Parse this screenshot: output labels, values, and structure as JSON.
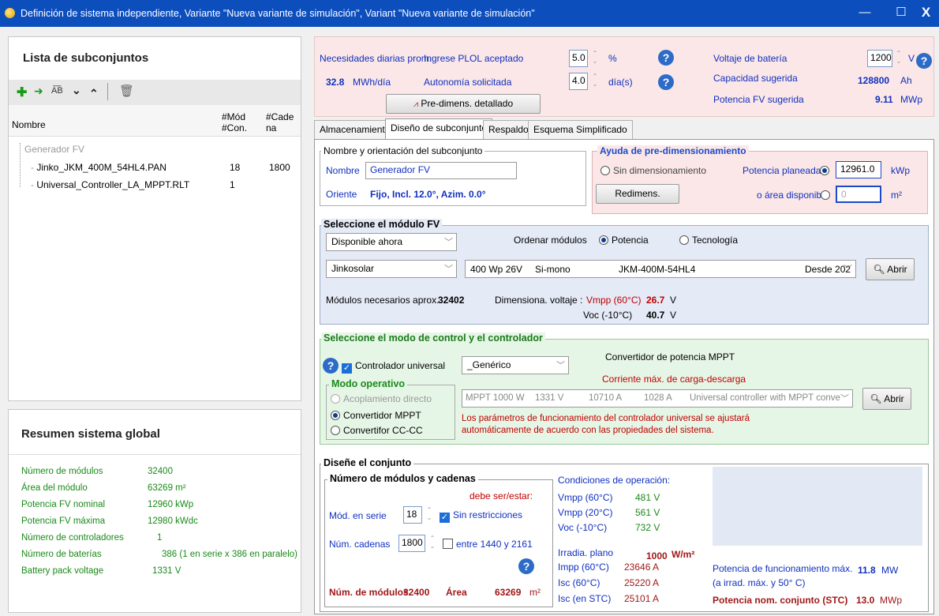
{
  "window": {
    "title": "Definición de sistema independiente, Variante  \"Nueva variante de simulación\", Variant  \"Nueva variante de simulación\"",
    "min": "—",
    "max": "☐",
    "close": "X"
  },
  "left": {
    "title": "Lista de subconjuntos",
    "headers": {
      "name": "Nombre",
      "mod": "#Mód\n#Con.",
      "cad": "#Cade\nna"
    },
    "root": "Generador FV",
    "items": [
      {
        "name": "Jinko_JKM_400M_54HL4.PAN",
        "mod": "18",
        "cad": "1800"
      },
      {
        "name": "Universal_Controller_LA_MPPT.RLT",
        "mod": "1",
        "cad": ""
      }
    ]
  },
  "summary": {
    "title": "Resumen sistema global",
    "rows": [
      {
        "label": "Número de módulos",
        "value": "32400"
      },
      {
        "label": "Área del módulo",
        "value": "63269 m²"
      },
      {
        "label": "Potencia FV nominal",
        "value": "12960  kWp"
      },
      {
        "label": "Potencia FV máxima",
        "value": "12980  kWdc"
      },
      {
        "label": "Número de controladores",
        "value": "1"
      },
      {
        "label": "Número de baterías",
        "value": "386 (1 en serie x 386 en paralelo)"
      },
      {
        "label": "Battery pack voltage",
        "value": "1331  V"
      }
    ]
  },
  "top": {
    "needs_label": "Necesidades diarias prom.",
    "plol_label": "Ingrese PLOL aceptado",
    "plol_value": "5.0",
    "plol_unit": "%",
    "daily_value": "32.8",
    "daily_unit": "MWh/día",
    "autonomy_label": "Autonomía solicitada",
    "autonomy_value": "4.0",
    "autonomy_unit": "día(s)",
    "predim_button": "Pre-dimens. detallado",
    "battery_voltage_label": "Voltaje de batería",
    "battery_voltage_value": "1200",
    "battery_voltage_unit": "V",
    "capacity_label": "Capacidad sugerida",
    "capacity_value": "128800",
    "capacity_unit": "Ah",
    "pv_power_label": "Potencia FV sugerida",
    "pv_power_value": "9.11",
    "pv_power_unit": "MWp"
  },
  "tabs": [
    "Almacenamiento",
    "Diseño de subconjunto",
    "Respaldo",
    "Esquema Simplificado"
  ],
  "orient": {
    "group": "Nombre y orientación del subconjunto",
    "name_label": "Nombre",
    "name_value": "Generador FV",
    "orient_label": "Oriente",
    "orient_value": "Fijo, Incl. 12.0°, Azim. 0.0°"
  },
  "presizing": {
    "group": "Ayuda de pre-dimensionamiento",
    "no_sizing": "Sin dimensionamiento",
    "planned_label": "Potencia planeada",
    "planned_value": "12961.0",
    "planned_unit": "kWp",
    "resize_button": "Redimens.",
    "area_label": "o área disponible",
    "area_value": "0",
    "area_unit": "m²"
  },
  "module": {
    "group": "Seleccione el módulo FV",
    "availability": "Disponible ahora",
    "sort_label": "Ordenar módulos",
    "sort_power": "Potencia",
    "sort_tech": "Tecnología",
    "maker": "Jinkosolar",
    "model_power": "400 Wp 26V",
    "model_tech": "Si-mono",
    "model_name": "JKM-400M-54HL4",
    "model_since": "Desde 202",
    "open_button": "Abrir",
    "needed_label": "Módulos necesarios aprox.",
    "needed_value": "32402",
    "dim_label": "Dimensiona. voltaje :",
    "vmpp_label": "Vmpp (60°C)",
    "vmpp_value": "26.7",
    "voc_label": "Voc (-10°C)",
    "voc_value": "40.7",
    "volt_unit": "V"
  },
  "controller": {
    "group": "Seleccione el modo de control y el controlador",
    "universal": "Controlador universal",
    "generic": "_Genérico",
    "converter_title": "Convertidor de potencia MPPT",
    "max_current": "Corriente máx. de carga-descarga",
    "mode_group": "Modo operativo",
    "mode_direct": "Acoplamiento directo",
    "mode_mppt": "Convertidor MPPT",
    "mode_dcdc": "Convertifor CC-CC",
    "model_row": [
      "MPPT 1000 W",
      "1331 V",
      "10710 A",
      "1028 A",
      "Universal controller with MPPT conve"
    ],
    "open_button": "Abrir",
    "note": "Los parámetros de funcionamiento del controlador universal se ajustará\nautomáticamente de acuerdo con las propiedades del sistema."
  },
  "array": {
    "group": "Diseñe el conjunto",
    "sub_group": "Número de módulos y cadenas",
    "must_be": "debe ser/estar:",
    "series_label": "Mód. en serie",
    "series_value": "18",
    "no_restrict": "Sin restricciones",
    "strings_label": "Núm. cadenas",
    "strings_value": "1800",
    "between": "entre 1440 y 2161",
    "total_label": "Núm. de módulos",
    "total_value": "32400",
    "area_label": "Área",
    "area_value": "63269",
    "area_unit": "m²",
    "op_title": "Condiciones de operación:",
    "op": [
      {
        "label": "Vmpp (60°C)",
        "value": "481 V"
      },
      {
        "label": "Vmpp (20°C)",
        "value": "561 V"
      },
      {
        "label": "Voc (-10°C)",
        "value": "732 V"
      }
    ],
    "irr_label": "Irradia. plano",
    "irr_value": "1000",
    "irr_unit": "W/m²",
    "cur": [
      {
        "label": "Impp (60°C)",
        "value": "23646 A"
      },
      {
        "label": "Isc (60°C)",
        "value": "25220 A"
      },
      {
        "label": "Isc (en STC)",
        "value": "25101 A"
      }
    ],
    "maxpow_label": "Potencia de funcionamiento máx.",
    "maxpow_sub": "(a irrad. máx. y 50° C)",
    "maxpow_value": "11.8",
    "maxpow_unit": "MW",
    "nom_label": "Potencia nom. conjunto (STC)",
    "nom_value": "13.0",
    "nom_unit": "MWp"
  }
}
